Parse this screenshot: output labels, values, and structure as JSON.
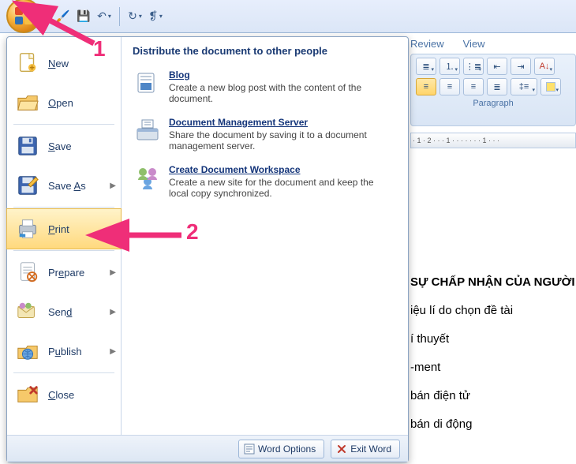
{
  "qat": {
    "tools": [
      "brush",
      "save",
      "undo",
      "redo",
      "style"
    ]
  },
  "ribbon": {
    "tabs": [
      "Review",
      "View"
    ],
    "group_label": "Paragraph"
  },
  "ruler": {
    "text": "· 1 · 2 · · · 1 · · · · · · · 1 · · ·"
  },
  "office_menu": {
    "left": [
      {
        "key": "new",
        "label": "New",
        "mn": "N",
        "arrow": false
      },
      {
        "key": "open",
        "label": "Open",
        "mn": "O",
        "arrow": false
      },
      {
        "key": "save",
        "label": "Save",
        "mn": "S",
        "arrow": false
      },
      {
        "key": "saveas",
        "label": "Save As",
        "mn": "A",
        "arrow": true
      },
      {
        "key": "print",
        "label": "Print",
        "mn": "P",
        "arrow": true,
        "hl": true
      },
      {
        "key": "prepare",
        "label": "Prepare",
        "mn": "e",
        "arrow": true
      },
      {
        "key": "send",
        "label": "Send",
        "mn": "d",
        "arrow": true
      },
      {
        "key": "publish",
        "label": "Publish",
        "mn": "u",
        "arrow": true
      },
      {
        "key": "close",
        "label": "Close",
        "mn": "C",
        "arrow": false
      }
    ],
    "right": {
      "heading": "Distribute the document to other people",
      "items": [
        {
          "title": "Blog",
          "desc": "Create a new blog post with the content of the document."
        },
        {
          "title": "Document Management Server",
          "desc": "Share the document by saving it to a document management server."
        },
        {
          "title": "Create Document Workspace",
          "desc": "Create a new site for the document and keep the local copy synchronized."
        }
      ]
    },
    "footer": {
      "options": "Word Options",
      "exit": "Exit Word"
    }
  },
  "document": {
    "lines": [
      {
        "text": "SỰ CHẤP NHẬN CỦA NGƯỜI",
        "bold": true
      },
      {
        "text": "iệu lí do chọn đề tài",
        "bold": false
      },
      {
        "text": "í thuyết",
        "bold": false
      },
      {
        "text": "-ment",
        "bold": false
      },
      {
        "text": "bán điện tử",
        "bold": false
      },
      {
        "text": "bán di động",
        "bold": false
      }
    ]
  },
  "annotations": {
    "one": "1",
    "two": "2"
  }
}
